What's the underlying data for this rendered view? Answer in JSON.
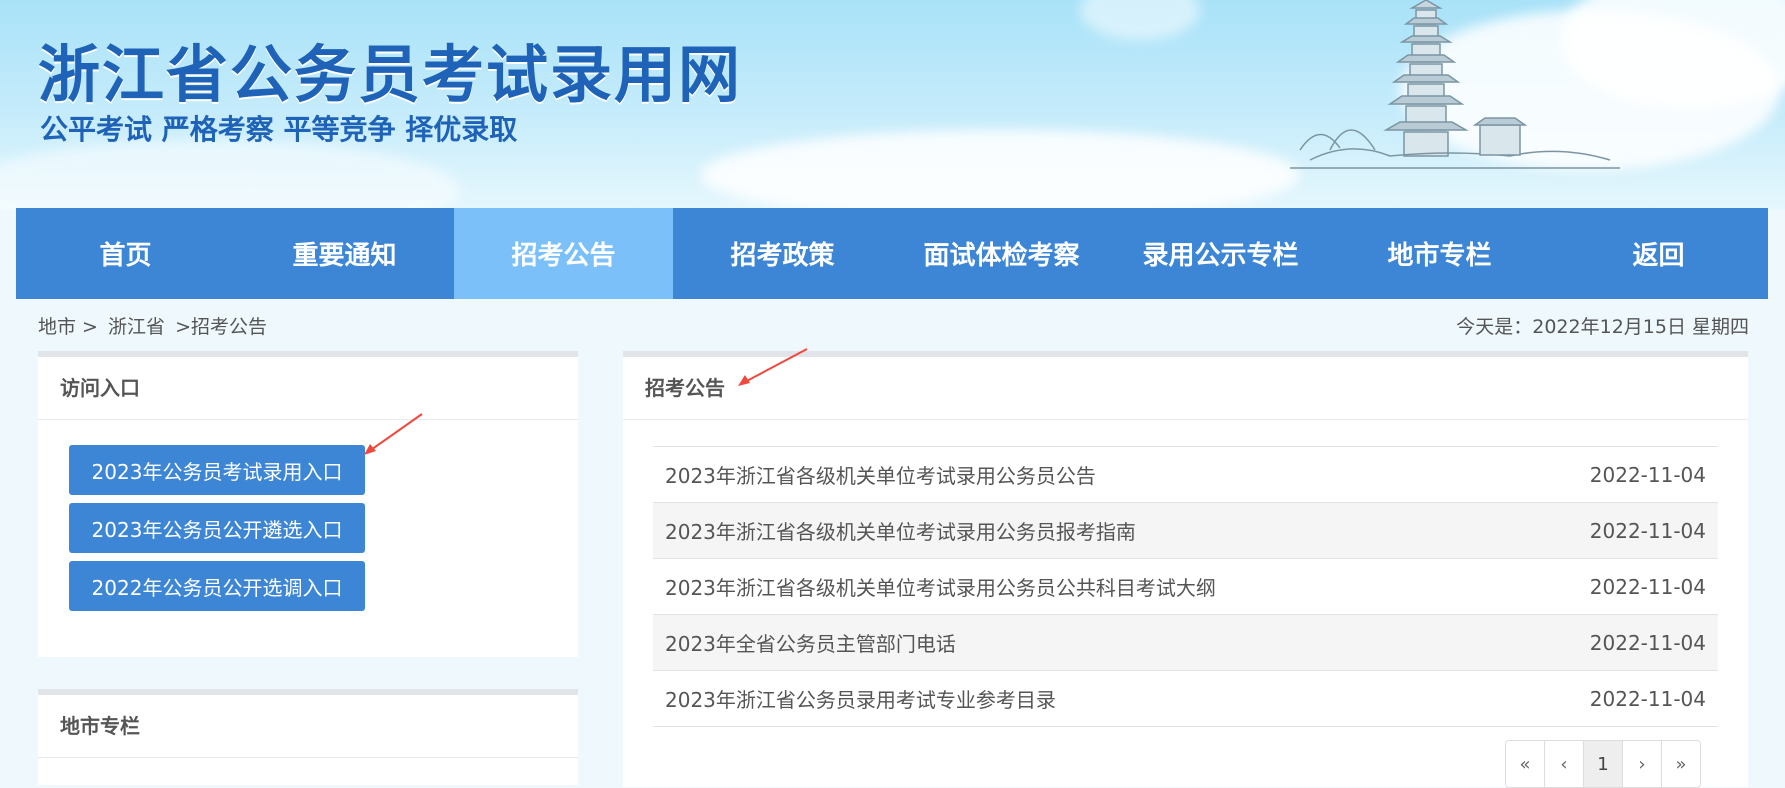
{
  "header": {
    "title": "浙江省公务员考试录用网",
    "slogan": "公平考试 严格考察 平等竞争 择优录取"
  },
  "nav": {
    "items": [
      "首页",
      "重要通知",
      "招考公告",
      "招考政策",
      "面试体检考察",
      "录用公示专栏",
      "地市专栏",
      "返回"
    ],
    "active": "招考公告"
  },
  "breadcrumb": [
    "地市 >",
    "浙江省",
    ">招考公告"
  ],
  "today": "今天是：2022年12月15日 星期四",
  "access": {
    "title": "访问入口",
    "buttons": [
      "2023年公务员考试录用入口",
      "2023年公务员公开遴选入口",
      "2022年公务员公开选调入口"
    ]
  },
  "city_column": {
    "title": "地市专栏"
  },
  "announcements": {
    "title": "招考公告",
    "items": [
      {
        "title": "2023年浙江省各级机关单位考试录用公务员公告",
        "date": "2022-11-04"
      },
      {
        "title": "2023年浙江省各级机关单位考试录用公务员报考指南",
        "date": "2022-11-04"
      },
      {
        "title": "2023年浙江省各级机关单位考试录用公务员公共科目考试大纲",
        "date": "2022-11-04"
      },
      {
        "title": "2023年全省公务员主管部门电话",
        "date": "2022-11-04"
      },
      {
        "title": "2023年浙江省公务员录用考试专业参考目录",
        "date": "2022-11-04"
      }
    ]
  },
  "pagination": [
    "«",
    "‹",
    "1",
    "›",
    "»"
  ],
  "colors": {
    "nav": "#3d86d5",
    "nav_active": "#7cc0fa",
    "title": "#1f63b8",
    "arrow": "#f0483e"
  }
}
